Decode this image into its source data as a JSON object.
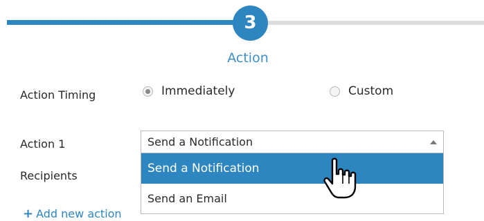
{
  "stepper": {
    "current_step": "3",
    "step_title": "Action"
  },
  "action_timing": {
    "label": "Action Timing",
    "options": [
      {
        "label": "Immediately",
        "selected": true
      },
      {
        "label": "Custom",
        "selected": false
      }
    ]
  },
  "action1": {
    "label": "Action 1",
    "selected_value": "Send a Notification",
    "dropdown_open": true,
    "options": [
      {
        "label": "Send a Notification",
        "highlighted": true
      },
      {
        "label": "Send an Email",
        "highlighted": false
      }
    ]
  },
  "recipients": {
    "label": "Recipients"
  },
  "add_action": {
    "label": "Add new action",
    "icon": "plus-icon"
  },
  "colors": {
    "accent": "#2e86c1",
    "track_inactive": "#dcdcdc",
    "text": "#2a2a2a"
  }
}
